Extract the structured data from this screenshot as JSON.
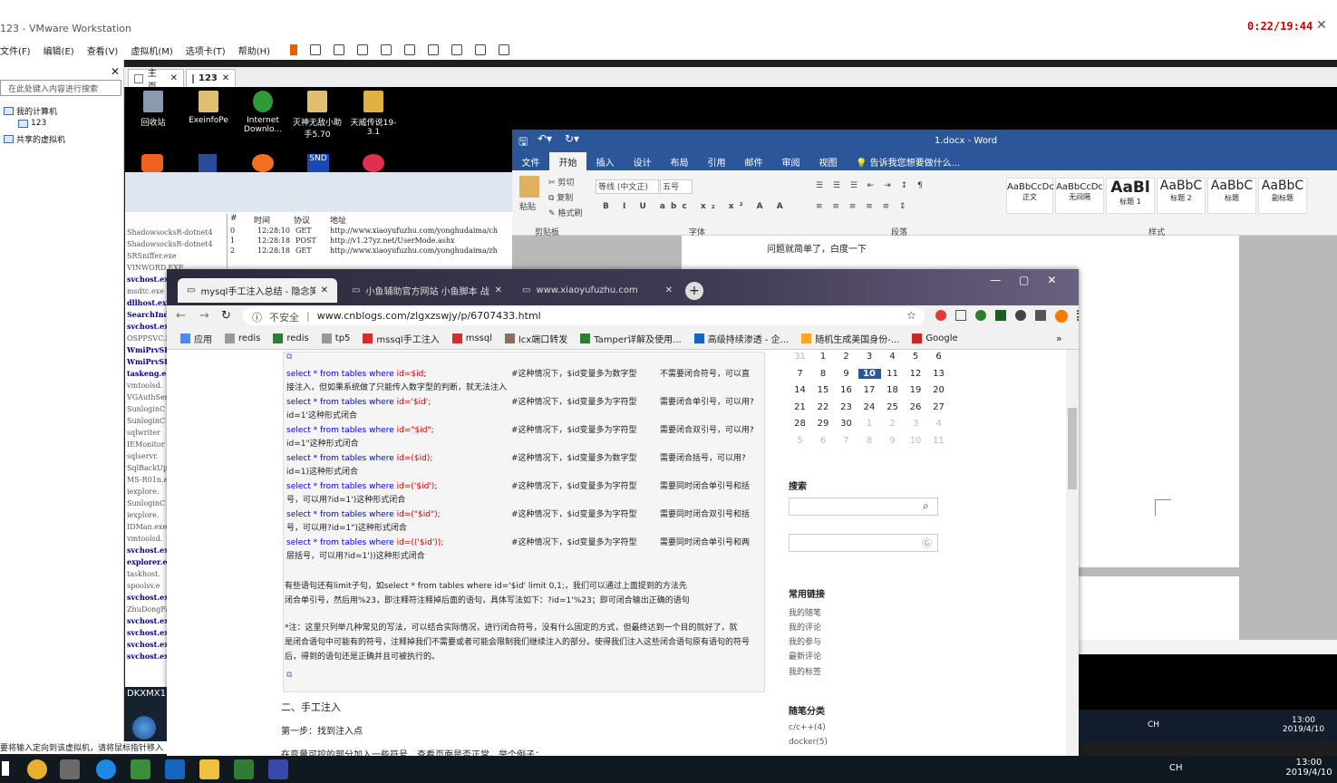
{
  "vmware": {
    "title": "123 - VMware Workstation",
    "red_clock": "0:22/19:44",
    "menu": [
      "文件(F)",
      "编辑(E)",
      "查看(V)",
      "虚拟机(M)",
      "选项卡(T)",
      "帮助(H)"
    ],
    "library": {
      "search_placeholder": "在此处键入内容进行搜索",
      "tree": [
        "我的计算机",
        "123",
        "共享的虚拟机"
      ]
    },
    "tabs": [
      "主页",
      "123"
    ],
    "status": "要将输入定向到该虚拟机，请将鼠标指针移入其中"
  },
  "desktop_icons": [
    {
      "label": "回收站",
      "color": "#8a9bb0"
    },
    {
      "label": "ExeinfoPe",
      "color": "#e0c070"
    },
    {
      "label": "Internet Downlo...",
      "color": "#2d9b3a"
    },
    {
      "label": "灭神无敌小助手5.70",
      "color": "#e0c070"
    },
    {
      "label": "天威传说19-3.1",
      "color": "#e0b040"
    }
  ],
  "sniffer": {
    "processes": [
      "ShadowsocksR-dotnet4",
      "ShadowsocksR-dotnet4",
      "SRSniffer.exe",
      "VINWORD.EXE",
      "svchost.exe",
      "msdtc.exe",
      "dllhost.exe",
      "SearchInd",
      "svchost.exe",
      "OSPPSVC.E",
      "WmiPrvSE.",
      "WmiPrvSE.",
      "taskeng.e",
      "vmtoolsd.",
      "VGAuthSer",
      "SunloginC",
      "SunloginC",
      "sqlwriter",
      "IEMonitor",
      "sqlservr.",
      "SqlBackUp",
      "MS-R01n.e",
      "iexplore.",
      "SunloginC",
      "iexplore.",
      "IDMan.exe",
      "vmtoolsd.",
      "svchost.ex",
      "explorer.e",
      "taskhost.",
      "spoolsv.e",
      "svchost.ex",
      "ZhuDongFa",
      "svchost.ex",
      "svchost.ex",
      "svchost.ex",
      "svchost.ex"
    ],
    "blue_rows": [
      4,
      6,
      7,
      8,
      10,
      11,
      12,
      27,
      28,
      31,
      33,
      34,
      35,
      36
    ],
    "columns": [
      "#",
      "时间",
      "协议",
      "地址"
    ],
    "rows": [
      [
        "0",
        "12:28:10",
        "GET",
        "http://www.xiaoyufuzhu.com/yonghudaima/ch"
      ],
      [
        "1",
        "12:28:18",
        "POST",
        "http://v1.27yz.net/UserMode.ashx"
      ],
      [
        "2",
        "12:28:18",
        "GET",
        "http://www.xiaoyufuzhu.com/yonghudaima/zh"
      ]
    ]
  },
  "word": {
    "title": "1.docx - Word",
    "tabs": [
      "文件",
      "开始",
      "插入",
      "设计",
      "布局",
      "引用",
      "邮件",
      "审阅",
      "视图"
    ],
    "tell_me": "告诉我您想要做什么...",
    "clipboard": [
      "剪切",
      "复制",
      "格式刷",
      "粘贴"
    ],
    "font_name": "等线 (中文正)",
    "font_size": "五号",
    "groups": [
      "剪贴板",
      "字体",
      "段落",
      "样式"
    ],
    "styles": [
      {
        "preview": "AaBbCcDc",
        "name": "正文"
      },
      {
        "preview": "AaBbCcDc",
        "name": "无间隔"
      },
      {
        "preview": "AaBl",
        "name": "标题 1"
      },
      {
        "preview": "AaBbC",
        "name": "标题 2"
      },
      {
        "preview": "AaBbC",
        "name": "标题"
      },
      {
        "preview": "AaBbC",
        "name": "副标题"
      }
    ],
    "doc_text": "问题就简单了，白度一下"
  },
  "chrome": {
    "tabs": [
      "mysql手工注入总结 - 隐念笑 - 博",
      "小鱼辅助官方网站 小鱼脚本 战天",
      "www.xiaoyufuzhu.com"
    ],
    "security": "不安全",
    "url": "www.cnblogs.com/zlgxzswjy/p/6707433.html",
    "bookmarks": [
      {
        "label": "应用",
        "color": "#4a8af4"
      },
      {
        "label": "redis",
        "color": "#999"
      },
      {
        "label": "redis",
        "color": "#2e7d32"
      },
      {
        "label": "tp5",
        "color": "#999"
      },
      {
        "label": "mssql手工注入",
        "color": "#d32f2f"
      },
      {
        "label": "mssql",
        "color": "#d32f2f"
      },
      {
        "label": "lcx端口转发",
        "color": "#8d6e63"
      },
      {
        "label": "Tamper详解及使用...",
        "color": "#2e7d32"
      },
      {
        "label": "高级持续渗透 - 企...",
        "color": "#1565c0"
      },
      {
        "label": "随机生成美国身份-...",
        "color": "#f9a825"
      },
      {
        "label": "Google",
        "color": "#c62828"
      }
    ]
  },
  "article": {
    "code_lines": [
      {
        "kw": "select * from tables where ",
        "q": "id=$id;",
        "comment": "#这种情况下，$id变量多为数字型",
        "note": "不需要闭合符号，可以直",
        "cont": "接注入，但如果系统做了只能传入数字型的判断，就无法注入"
      },
      {
        "kw": "select * from tables where ",
        "q": "id='$id';",
        "comment": "#这种情况下，$id变量多为字符型",
        "note": "需要闭合单引号，可以用?",
        "cont": "id=1'这种形式闭合"
      },
      {
        "kw": "select * from tables where ",
        "q": "id=\"$id\";",
        "comment": "#这种情况下，$id变量多为字符型",
        "note": "需要闭合双引号，可以用?",
        "cont": "id=1\"这种形式闭合"
      },
      {
        "kw": "select * from tables where ",
        "q": "id=($id);",
        "comment": "#这种情况下，$id变量多为数字型",
        "note": "需要闭合括号，可以用?",
        "cont": "id=1)这种形式闭合"
      },
      {
        "kw": "select * from tables where ",
        "q": "id=('$id');",
        "comment": "#这种情况下，$id变量多为字符型",
        "note": "需要同时闭合单引号和括",
        "cont": "号，可以用?id=1')这种形式闭合"
      },
      {
        "kw": "select * from tables where ",
        "q": "id=(\"$id\");",
        "comment": "#这种情况下，$id变量多为字符型",
        "note": "需要同时闭合双引号和括",
        "cont": "号，可以用?id=1\")这种形式闭合"
      },
      {
        "kw": "select * from tables where ",
        "q": "id=(('$id'));",
        "comment": "#这种情况下，$id变量多为字符型",
        "note": "需要同时闭合单引号和两",
        "cont": "层括号，可以用?id=1'))这种形式闭合"
      }
    ],
    "limit_para": [
      "有些语句还有limit子句，如select * from tables where id='$id' limit 0,1;，我们可以通过上面提到的方法先",
      "闭合单引号，然后用%23，即注释符注释掉后面的语句，具体写法如下：?id=1'%23；即可闭合输出正确的语句"
    ],
    "note_para": [
      "*注：这里只列举几种常见的写法，可以结合实际情况，进行闭合符号，没有什么固定的方式，但最终达到一个目的就好了，就",
      "是闭合语句中可能有的符号，注释掉我们不需要或者可能会限制我们继续注入的部分。使得我们注入这些闭合语句原有语句的符号",
      "后，得到的语句还是正确并且可被执行的。"
    ],
    "heading": "二、手工注入",
    "step1": "第一步：找到注入点",
    "step1_text": "在变量可控的部分加入一些符号，查看页面是否正常，举个例子："
  },
  "calendar": {
    "weeks": [
      [
        "31",
        "1",
        "2",
        "3",
        "4",
        "5",
        "6"
      ],
      [
        "7",
        "8",
        "9",
        "10",
        "11",
        "12",
        "13"
      ],
      [
        "14",
        "15",
        "16",
        "17",
        "18",
        "19",
        "20"
      ],
      [
        "21",
        "22",
        "23",
        "24",
        "25",
        "26",
        "27"
      ],
      [
        "28",
        "29",
        "30",
        "1",
        "2",
        "3",
        "4"
      ],
      [
        "5",
        "6",
        "7",
        "8",
        "9",
        "10",
        "11"
      ]
    ],
    "today": "10"
  },
  "sidebar": {
    "search_title": "搜索",
    "links_title": "常用链接",
    "links": [
      "我的随笔",
      "我的评论",
      "我的参与",
      "最新评论",
      "我的标签"
    ],
    "category_title": "随笔分类",
    "categories": [
      "c/c++(4)",
      "docker(5)"
    ]
  },
  "guest_taskbar": {
    "label": "DKXMX1",
    "time": "13:00",
    "date": "2019/4/10",
    "ime": "CH"
  },
  "host_taskbar": {
    "time": "13:00",
    "date": "2019/4/10",
    "ime": "CH"
  },
  "colors": {
    "word_blue": "#2b579a",
    "accent_red": "#d00000",
    "today_blue": "#2b579a"
  }
}
